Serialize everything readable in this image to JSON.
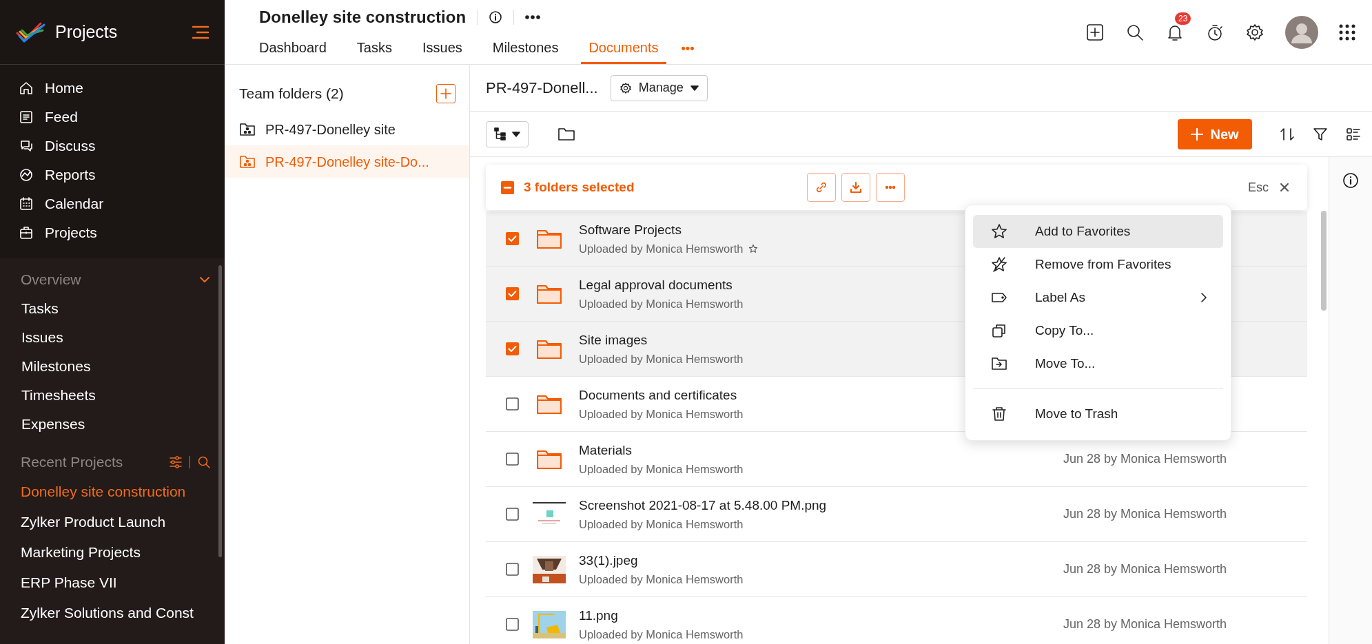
{
  "sidebar": {
    "app_name": "Projects",
    "nav": [
      {
        "label": "Home"
      },
      {
        "label": "Feed"
      },
      {
        "label": "Discuss"
      },
      {
        "label": "Reports"
      },
      {
        "label": "Calendar"
      },
      {
        "label": "Projects"
      }
    ],
    "overview": {
      "title": "Overview",
      "expanded": true,
      "items": [
        "Tasks",
        "Issues",
        "Milestones",
        "Timesheets",
        "Expenses"
      ]
    },
    "recent_projects": {
      "title": "Recent Projects",
      "items": [
        {
          "label": "Donelley site construction",
          "selected": true
        },
        {
          "label": "Zylker Product Launch",
          "selected": false
        },
        {
          "label": "Marketing Projects",
          "selected": false
        },
        {
          "label": "ERP Phase VII",
          "selected": false
        },
        {
          "label": "Zylker Solutions and Const",
          "selected": false
        }
      ]
    }
  },
  "header": {
    "title": "Donelley site construction",
    "more_tabs": "•••",
    "notification_count": "23",
    "tabs": [
      {
        "label": "Dashboard",
        "selected": false
      },
      {
        "label": "Tasks",
        "selected": false
      },
      {
        "label": "Issues",
        "selected": false
      },
      {
        "label": "Milestones",
        "selected": false
      },
      {
        "label": "Documents",
        "selected": true
      }
    ]
  },
  "folders": {
    "title": "Team folders (2)",
    "items": [
      {
        "label": "PR-497-Donelley site",
        "selected": false
      },
      {
        "label": "PR-497-Donelley site-Do...",
        "selected": true
      }
    ]
  },
  "breadcrumb": "PR-497-Donell...",
  "manage_button": "Manage",
  "new_button": "New",
  "selection": {
    "indeterminate": true,
    "label": "3 folders selected",
    "esc": "Esc"
  },
  "files": [
    {
      "name": "Software Projects",
      "uploader": "Uploaded by Monica Hemsworth",
      "checked": true,
      "favorite": true,
      "kind": "folder"
    },
    {
      "name": "Legal approval documents",
      "uploader": "Uploaded by Monica Hemsworth",
      "checked": true,
      "favorite": false,
      "kind": "folder"
    },
    {
      "name": "Site images",
      "uploader": "Uploaded by Monica Hemsworth",
      "checked": true,
      "favorite": false,
      "kind": "folder"
    },
    {
      "name": "Documents and certificates",
      "uploader": "Uploaded by Monica Hemsworth",
      "checked": false,
      "favorite": false,
      "kind": "folder"
    },
    {
      "name": "Materials",
      "uploader": "Uploaded by Monica Hemsworth",
      "checked": false,
      "favorite": false,
      "kind": "folder",
      "modified": "Jun 28 by Monica Hemsworth"
    },
    {
      "name": "Screenshot 2021-08-17 at 5.48.00 PM.png",
      "uploader": "Uploaded by Monica Hemsworth",
      "checked": false,
      "favorite": false,
      "kind": "picture",
      "modified": "Jun 28 by Monica Hemsworth"
    },
    {
      "name": "33(1).jpeg",
      "uploader": "Uploaded by Monica Hemsworth",
      "checked": false,
      "favorite": false,
      "kind": "picture",
      "modified": "Jun 28 by Monica Hemsworth"
    },
    {
      "name": "11.png",
      "uploader": "Uploaded by Monica Hemsworth",
      "checked": false,
      "favorite": false,
      "kind": "picture",
      "modified": "Jun 28 by Monica Hemsworth"
    }
  ],
  "context_menu": {
    "groups": [
      {
        "items": [
          {
            "label": "Add to Favorites",
            "selected": true,
            "submenu": false
          },
          {
            "label": "Remove from Favorites",
            "selected": false,
            "submenu": false
          },
          {
            "label": "Label As",
            "selected": false,
            "submenu": true
          },
          {
            "label": "Copy To...",
            "selected": false,
            "submenu": false
          },
          {
            "label": "Move To...",
            "selected": false,
            "submenu": false
          }
        ]
      },
      {
        "items": [
          {
            "label": "Move to Trash",
            "selected": false,
            "submenu": false
          }
        ]
      }
    ]
  }
}
